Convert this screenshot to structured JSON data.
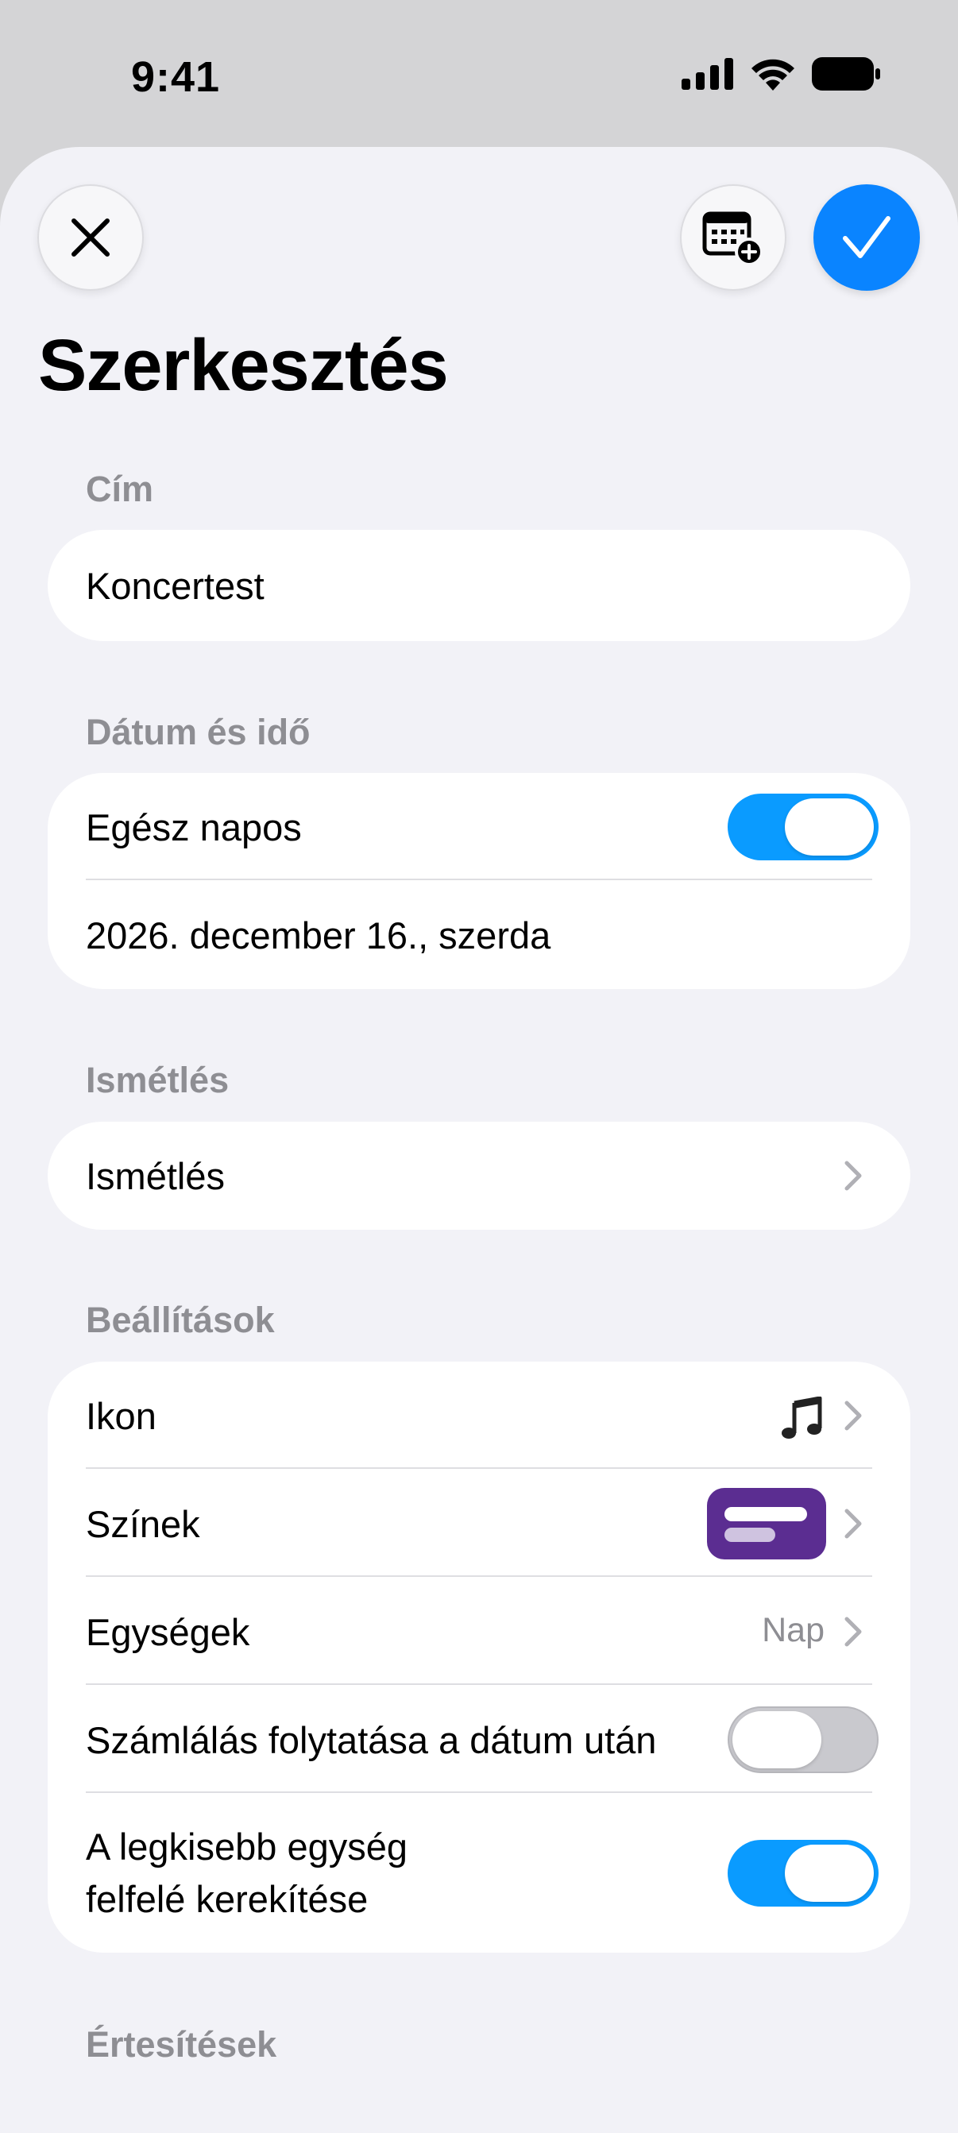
{
  "status_bar": {
    "time": "9:41"
  },
  "header": {
    "title": "Szerkesztés"
  },
  "sections": {
    "title": {
      "label": "Cím",
      "value": "Koncertest"
    },
    "datetime": {
      "label": "Dátum és idő",
      "all_day_label": "Egész napos",
      "all_day_on": true,
      "date": "2026. december 16., szerda"
    },
    "repeat": {
      "label": "Ismétlés",
      "row_label": "Ismétlés"
    },
    "settings": {
      "label": "Beállítások",
      "icon_label": "Ikon",
      "icon_value": "music-note-icon",
      "colors_label": "Színek",
      "colors_swatch": "#5b2d91",
      "units_label": "Egységek",
      "units_value": "Nap",
      "continue_label": "Számlálás folytatása a dátum után",
      "continue_on": false,
      "round_label_line1": "A legkisebb egység",
      "round_label_line2": "felfelé kerekítése",
      "round_on": true
    },
    "notifications": {
      "label": "Értesítések"
    }
  },
  "colors": {
    "accent": "#0a84ff",
    "toggle_on": "#0a9bff",
    "toggle_off": "#c7c7cc",
    "secondary_text": "#8e8e93"
  }
}
